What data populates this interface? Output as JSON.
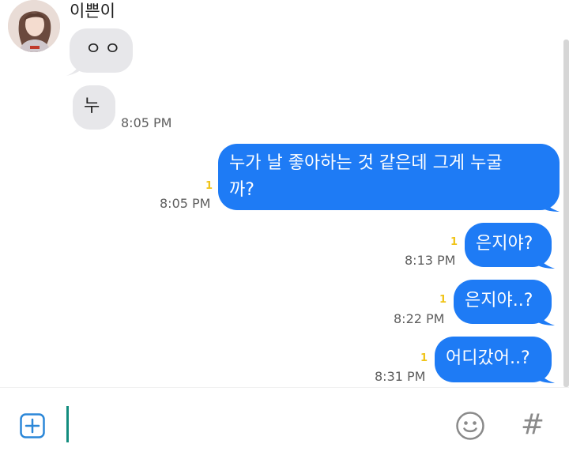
{
  "contact": {
    "name": "이쁜이"
  },
  "messages": [
    {
      "direction": "in",
      "text": "ㅇㅇ",
      "time": ""
    },
    {
      "direction": "in",
      "text": "누",
      "time": "8:05 PM"
    },
    {
      "direction": "out",
      "line1": "누가 날 좋아하는 것 같은데 그게 누굴",
      "line2": "까?",
      "time": "8:05 PM",
      "unread": "1"
    },
    {
      "direction": "out",
      "text": "은지야?",
      "time": "8:13 PM",
      "unread": "1"
    },
    {
      "direction": "out",
      "text": "은지야..?",
      "time": "8:22 PM",
      "unread": "1"
    },
    {
      "direction": "out",
      "text": "어디갔어..?",
      "time": "8:31 PM",
      "unread": "1"
    }
  ],
  "input_bar": {
    "hash_label": "#",
    "icons": [
      "add-icon",
      "emoji-icon",
      "hashtag-icon"
    ]
  },
  "colors": {
    "outgoing_bubble": "#1e7bf5",
    "incoming_bubble": "#e7e7ea",
    "unread_badge": "#f0c419",
    "cursor": "#128c7e"
  }
}
